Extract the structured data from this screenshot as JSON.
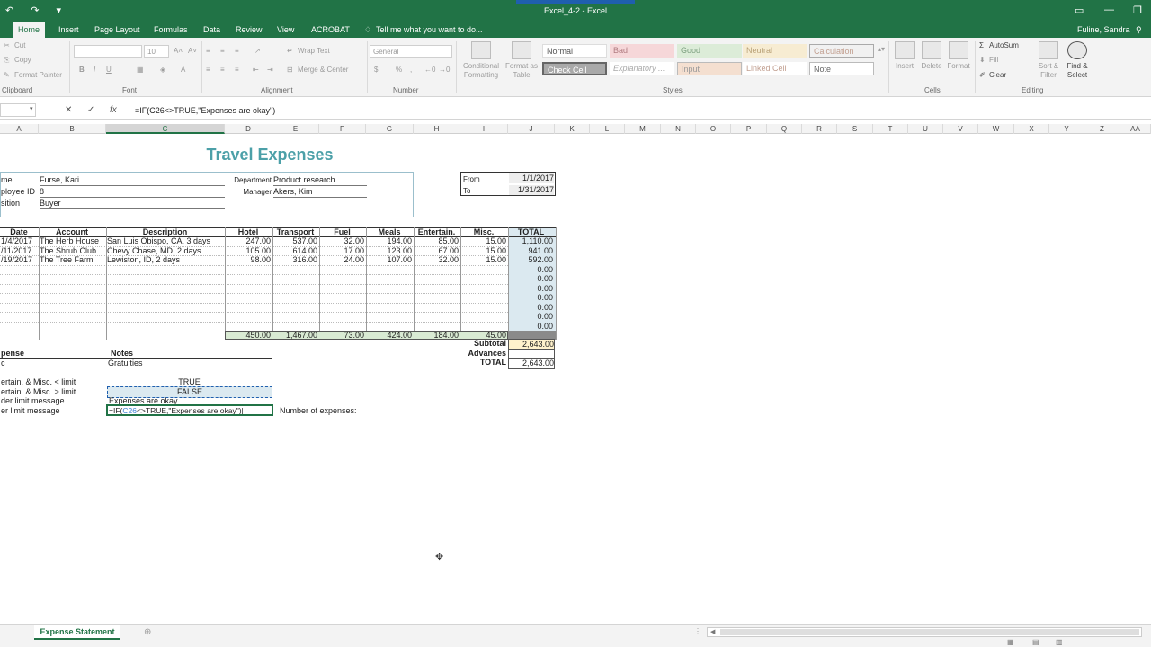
{
  "window": {
    "title": "Excel_4-2 - Excel",
    "user": "Fuline, Sandra"
  },
  "ribbon": {
    "tabs": [
      "Home",
      "Insert",
      "Page Layout",
      "Formulas",
      "Data",
      "Review",
      "View",
      "ACROBAT"
    ],
    "tell_me": "Tell me what you want to do...",
    "clipboard": {
      "cut": "Cut",
      "copy": "Copy",
      "format_painter": "Format Painter",
      "label": "Clipboard"
    },
    "font": {
      "size": "10",
      "bold": "B",
      "italic": "I",
      "underline": "U",
      "label": "Font"
    },
    "alignment": {
      "wrap_text": "Wrap Text",
      "merge_center": "Merge & Center",
      "label": "Alignment"
    },
    "number": {
      "format": "General",
      "currency": "$",
      "percent": "%",
      "comma": ",",
      "label": "Number"
    },
    "styles": {
      "conditional": "Conditional Formatting",
      "format_as_table": "Format as Table",
      "cells": [
        "Normal",
        "Bad",
        "Good",
        "Neutral",
        "Calculation",
        "Check Cell",
        "Explanatory ...",
        "Input",
        "Linked Cell",
        "Note"
      ],
      "label": "Styles"
    },
    "cells": {
      "insert": "Insert",
      "delete": "Delete",
      "format": "Format",
      "label": "Cells"
    },
    "editing": {
      "autosum": "AutoSum",
      "fill": "Fill",
      "clear": "Clear",
      "sort_filter": "Sort & Filter",
      "find_select": "Find & Select",
      "label": "Editing"
    }
  },
  "formula_bar": {
    "formula": "=IF(C26<>TRUE,\"Expenses are okay\")"
  },
  "columns": [
    "A",
    "B",
    "C",
    "D",
    "E",
    "F",
    "G",
    "H",
    "I",
    "J",
    "K",
    "L",
    "M",
    "N",
    "O",
    "P",
    "Q",
    "R",
    "S",
    "T",
    "U",
    "V",
    "W",
    "X",
    "Y",
    "Z",
    "AA"
  ],
  "sheet": {
    "title": "Travel Expenses",
    "info": {
      "name_label": "me",
      "name": "Furse, Kari",
      "empid_label": "ployee ID",
      "empid": "8",
      "position_label": "sition",
      "position": "Buyer",
      "dept_label": "Department",
      "dept": "Product research",
      "manager_label": "Manager",
      "manager": "Akers, Kim",
      "from_label": "From",
      "from": "1/1/2017",
      "to_label": "To",
      "to": "1/31/2017"
    },
    "headers": [
      "Date",
      "Account",
      "Description",
      "Hotel",
      "Transport",
      "Fuel",
      "Meals",
      "Entertain.",
      "Misc.",
      "TOTAL"
    ],
    "rows": [
      [
        "1/4/2017",
        "The Herb House",
        "San Luis Obispo, CA, 3 days",
        "247.00",
        "537.00",
        "32.00",
        "194.00",
        "85.00",
        "15.00",
        "1,110.00"
      ],
      [
        "/11/2017",
        "The Shrub Club",
        "Chevy Chase, MD, 2 days",
        "105.00",
        "614.00",
        "17.00",
        "123.00",
        "67.00",
        "15.00",
        "941.00"
      ],
      [
        "/19/2017",
        "The Tree Farm",
        "Lewiston, ID, 2 days",
        "98.00",
        "316.00",
        "24.00",
        "107.00",
        "32.00",
        "15.00",
        "592.00"
      ]
    ],
    "empty_totals": [
      "0.00",
      "0.00",
      "0.00",
      "0.00",
      "0.00",
      "0.00",
      "0.00"
    ],
    "col_totals": [
      "450.00",
      "1,467.00",
      "73.00",
      "424.00",
      "184.00",
      "45.00"
    ],
    "subtotal_label": "Subtotal",
    "subtotal": "2,643.00",
    "advances_label": "Advances",
    "total_label": "TOTAL",
    "total": "2,643.00",
    "notes": {
      "expense_header": "pense",
      "notes_header": "Notes",
      "misc_label": "c",
      "misc_note": "Gratuities",
      "under_label": "ertain. & Misc. < limit",
      "under_value": "TRUE",
      "over_label": "ertain. & Misc. > limit",
      "over_value": "FALSE",
      "under_msg_label": "der limit message",
      "under_msg": "Expenses are okay",
      "over_msg_label": "er limit message",
      "edit_pre": "=IF(",
      "edit_ref": "C26",
      "edit_post": "<>TRUE,\"Expenses are okay\")",
      "count_label": "Number of expenses:"
    }
  },
  "sheet_tab": "Expense Statement"
}
